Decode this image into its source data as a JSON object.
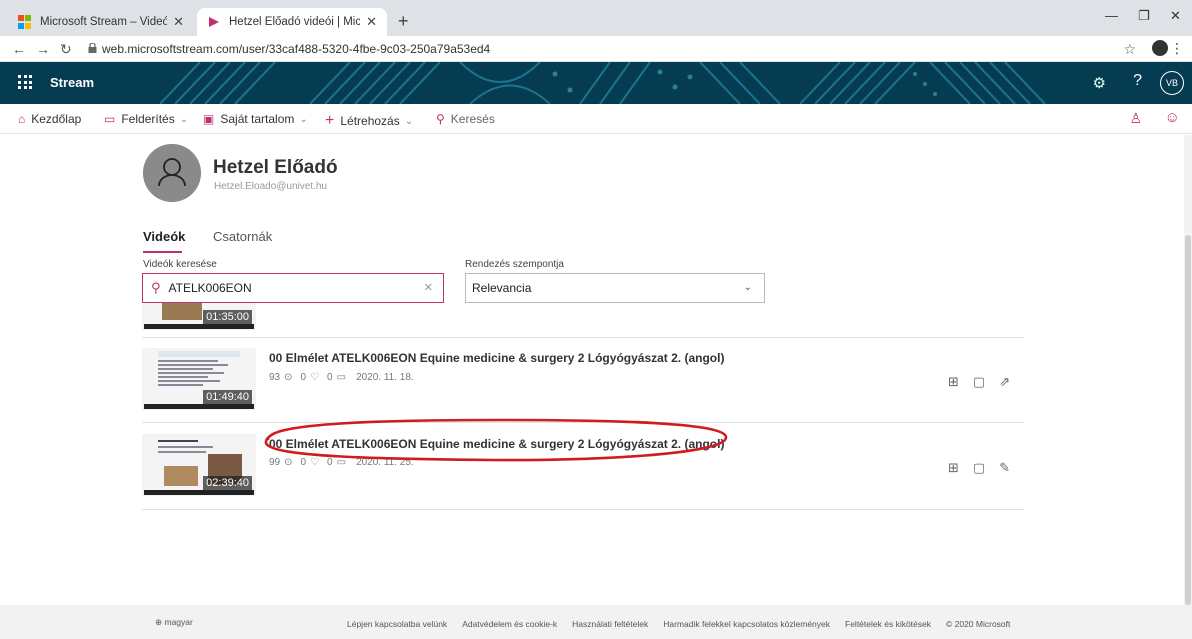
{
  "browser": {
    "tabs": [
      {
        "title": "Microsoft Stream – Videómegosz",
        "active": false
      },
      {
        "title": "Hetzel Előadó videói | Microsoft",
        "active": true
      }
    ],
    "url": "web.microsoftstream.com/user/33caf488-5320-4fbe-9c03-250a79a53ed4"
  },
  "header": {
    "brand": "Stream",
    "avatar_initials": "VB",
    "help": "?",
    "accent": "#063c52"
  },
  "nav": {
    "home": "Kezdőlap",
    "discover": "Felderítés",
    "my_content": "Saját tartalom",
    "create": "Létrehozás",
    "search": "Keresés",
    "accent": "#c03070"
  },
  "profile": {
    "name": "Hetzel Előadó",
    "email": "Hetzel.Eloado@univet.hu"
  },
  "tabs": {
    "videos": "Videók",
    "channels": "Csatornák"
  },
  "filters": {
    "search_label": "Videók keresése",
    "search_value": "ATELK006EON",
    "sort_label": "Rendezés szempontja",
    "sort_value": "Relevancia"
  },
  "videos": [
    {
      "duration": "01:35:00"
    },
    {
      "title": "00 Elmélet ATELK006EON Equine medicine & surgery 2 Lógyógyászat 2. (angol)",
      "views": "93",
      "likes": "0",
      "comments": "0",
      "date": "2020. 11. 18.",
      "duration": "01:49:40"
    },
    {
      "title": "00 Elmélet ATELK006EON Equine medicine & surgery 2 Lógyógyászat 2. (angol)",
      "views": "99",
      "likes": "0",
      "comments": "0",
      "date": "2020. 11. 25.",
      "duration": "02:39:40"
    }
  ],
  "footer": {
    "language": "magyar",
    "links": [
      "Lépjen kapcsolatba velünk",
      "Adatvédelem és cookie-k",
      "Használati feltételek",
      "Harmadik felekkel kapcsolatos közlemények",
      "Feltételek és kikötések",
      "© 2020 Microsoft"
    ]
  }
}
